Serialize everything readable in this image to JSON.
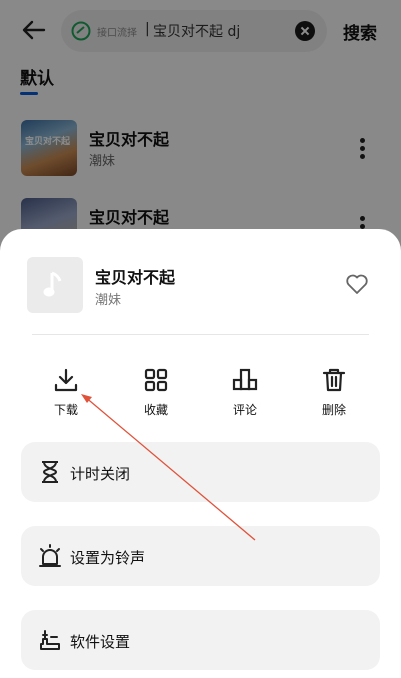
{
  "search": {
    "source_label": "接口流择",
    "separator": "|",
    "query": "宝贝对不起 dj",
    "button": "搜索"
  },
  "tabs": {
    "default": "默认"
  },
  "results": [
    {
      "title": "宝贝对不起",
      "artist": "潮妹",
      "cover_text": "宝贝对不起"
    },
    {
      "title": "宝贝对不起",
      "artist": "",
      "cover_text": ""
    }
  ],
  "sheet": {
    "title": "宝贝对不起",
    "artist": "潮妹",
    "actions": [
      {
        "label": "下载",
        "icon": "download-icon"
      },
      {
        "label": "收藏",
        "icon": "grid-icon"
      },
      {
        "label": "评论",
        "icon": "comment-blocks-icon"
      },
      {
        "label": "删除",
        "icon": "trash-icon"
      }
    ],
    "options": [
      {
        "label": "计时关闭",
        "icon": "hourglass-icon"
      },
      {
        "label": "设置为铃声",
        "icon": "alarm-icon"
      },
      {
        "label": "软件设置",
        "icon": "settings-icon"
      }
    ]
  },
  "colors": {
    "accent": "#0a5bd3",
    "annotation_arrow": "#e0523a",
    "card_bg": "#f2f2f2"
  }
}
